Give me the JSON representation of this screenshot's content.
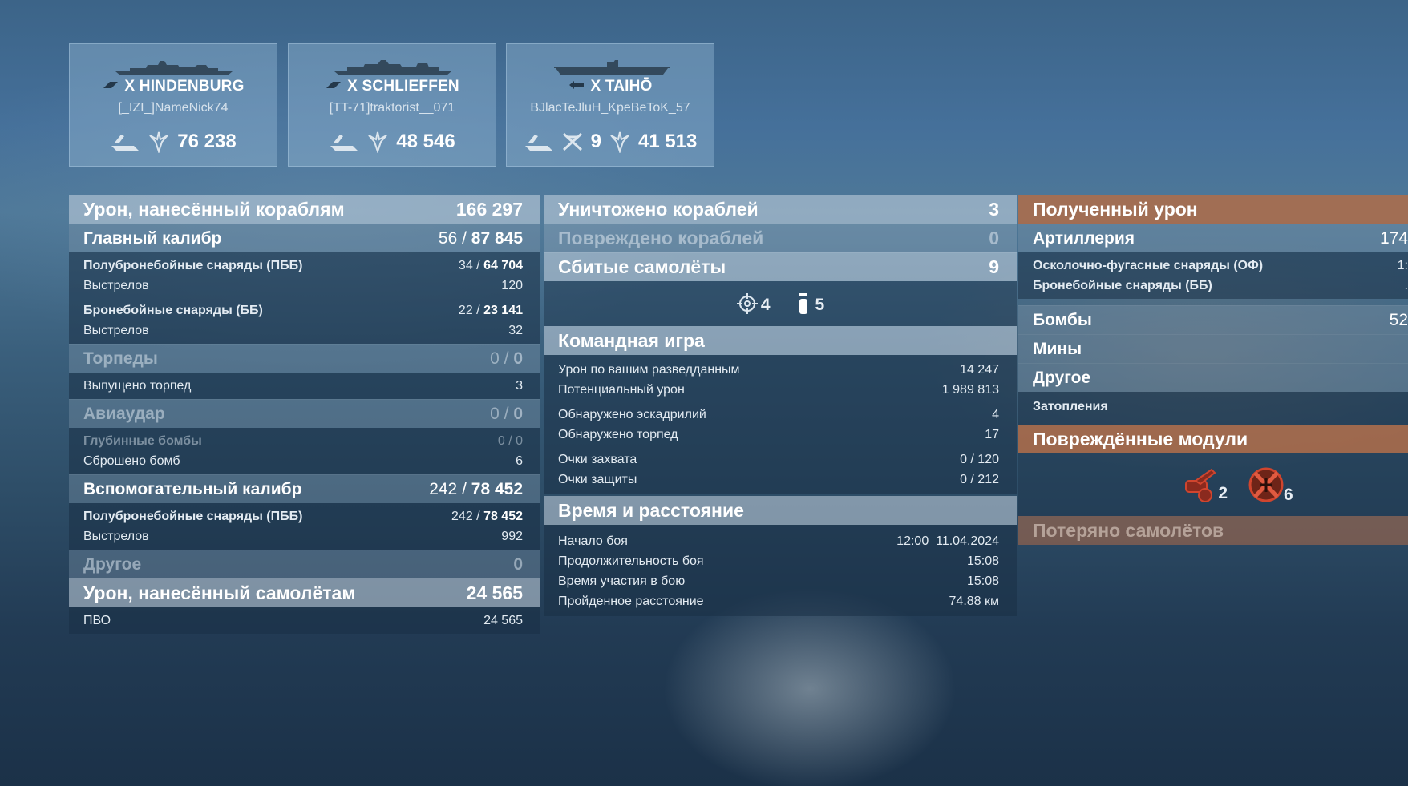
{
  "ships": [
    {
      "tier": "X",
      "name": "HINDENBURG",
      "player": "[_IZI_]NameNick74",
      "damage": "76 238",
      "planes": ""
    },
    {
      "tier": "X",
      "name": "SCHLIEFFEN",
      "player": "[TT-71]traktorist__071",
      "damage": "48 546",
      "planes": ""
    },
    {
      "tier": "X",
      "name": "TAIHŌ",
      "player": "BJlacTeJluH_KpeBeToK_57",
      "damage": "41 513",
      "planes": "9"
    }
  ],
  "left": {
    "ship_damage": {
      "label": "Урон, нанесённый кораблям",
      "value": "166 297"
    },
    "main": {
      "label": "Главный калибр",
      "hits": "56",
      "value": "87 845"
    },
    "sap": {
      "label": "Полубронебойные снаряды (ПББ)",
      "hits": "34",
      "value": "64 704",
      "shots_label": "Выстрелов",
      "shots": "120"
    },
    "ap": {
      "label": "Бронебойные снаряды (ББ)",
      "hits": "22",
      "value": "23 141",
      "shots_label": "Выстрелов",
      "shots": "32"
    },
    "torp": {
      "label": "Торпеды",
      "hits": "0",
      "value": "0",
      "fired_label": "Выпущено торпед",
      "fired": "3"
    },
    "air": {
      "label": "Авиаудар",
      "hits": "0",
      "value": "0",
      "depth_label": "Глубинные бомбы",
      "depth": "0 / 0",
      "bombs_label": "Сброшено бомб",
      "bombs": "6"
    },
    "secondary": {
      "label": "Вспомогательный калибр",
      "hits": "242",
      "value": "78 452",
      "sap_label": "Полубронебойные снаряды (ПББ)",
      "sap_hits": "242",
      "sap_value": "78 452",
      "shots_label": "Выстрелов",
      "shots": "992"
    },
    "other": {
      "label": "Другое",
      "value": "0"
    },
    "plane_damage": {
      "label": "Урон, нанесённый самолётам",
      "value": "24 565",
      "aa_label": "ПВО",
      "aa": "24 565"
    }
  },
  "middle": {
    "destroyed": {
      "label": "Уничтожено кораблей",
      "value": "3"
    },
    "damaged": {
      "label": "Повреждено кораблей",
      "value": "0"
    },
    "planes": {
      "label": "Сбитые самолёты",
      "value": "9",
      "fighter_count": "4",
      "aa_count": "5"
    },
    "team": {
      "label": "Командная игра",
      "rows": [
        {
          "label": "Урон по вашим разведданным",
          "value": "14 247"
        },
        {
          "label": "Потенциальный урон",
          "value": "1 989 813"
        },
        {
          "label": "Обнаружено эскадрилий",
          "value": "4"
        },
        {
          "label": "Обнаружено торпед",
          "value": "17"
        },
        {
          "label": "Очки захвата",
          "value": "0 / 120"
        },
        {
          "label": "Очки защиты",
          "value": "0 / 212"
        }
      ]
    },
    "time": {
      "label": "Время и расстояние",
      "rows": [
        {
          "label": "Начало боя",
          "value": "12:00  11.04.2024"
        },
        {
          "label": "Продолжительность боя",
          "value": "15:08"
        },
        {
          "label": "Время участия в бою",
          "value": "15:08"
        },
        {
          "label": "Пройденное расстояние",
          "value": "74.88 км"
        }
      ]
    }
  },
  "right": {
    "received": {
      "label": "Полученный урон"
    },
    "artillery": {
      "label": "Артиллерия",
      "value": "174"
    },
    "he": {
      "label": "Осколочно-фугасные снаряды (ОФ)",
      "value": "1:"
    },
    "ap": {
      "label": "Бронебойные снаряды (ББ)",
      "value": "."
    },
    "bombs": {
      "label": "Бомбы",
      "value": "52"
    },
    "mines": {
      "label": "Мины"
    },
    "other": {
      "label": "Другое"
    },
    "flooding": {
      "label": "Затопления"
    },
    "modules": {
      "label": "Повреждённые модули",
      "guns": "2",
      "planes": "6"
    },
    "lost_planes": {
      "label": "Потеряно самолётов"
    }
  },
  "colors": {
    "orange_header": "#b06c48",
    "light_header": "#c8d6e2"
  }
}
